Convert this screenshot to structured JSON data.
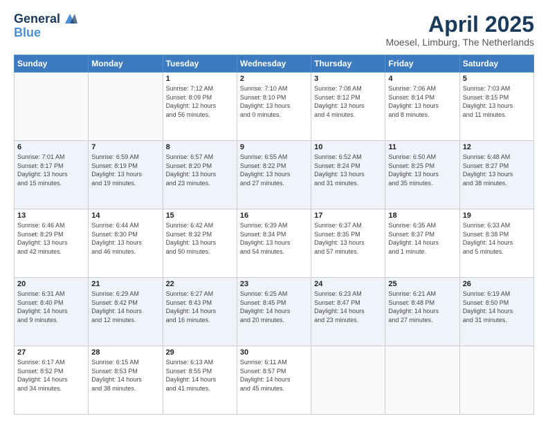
{
  "logo": {
    "line1": "General",
    "line2": "Blue"
  },
  "title": "April 2025",
  "subtitle": "Moesel, Limburg, The Netherlands",
  "weekdays": [
    "Sunday",
    "Monday",
    "Tuesday",
    "Wednesday",
    "Thursday",
    "Friday",
    "Saturday"
  ],
  "weeks": [
    [
      {
        "day": "",
        "info": ""
      },
      {
        "day": "",
        "info": ""
      },
      {
        "day": "1",
        "info": "Sunrise: 7:12 AM\nSunset: 8:09 PM\nDaylight: 12 hours\nand 56 minutes."
      },
      {
        "day": "2",
        "info": "Sunrise: 7:10 AM\nSunset: 8:10 PM\nDaylight: 13 hours\nand 0 minutes."
      },
      {
        "day": "3",
        "info": "Sunrise: 7:08 AM\nSunset: 8:12 PM\nDaylight: 13 hours\nand 4 minutes."
      },
      {
        "day": "4",
        "info": "Sunrise: 7:06 AM\nSunset: 8:14 PM\nDaylight: 13 hours\nand 8 minutes."
      },
      {
        "day": "5",
        "info": "Sunrise: 7:03 AM\nSunset: 8:15 PM\nDaylight: 13 hours\nand 11 minutes."
      }
    ],
    [
      {
        "day": "6",
        "info": "Sunrise: 7:01 AM\nSunset: 8:17 PM\nDaylight: 13 hours\nand 15 minutes."
      },
      {
        "day": "7",
        "info": "Sunrise: 6:59 AM\nSunset: 8:19 PM\nDaylight: 13 hours\nand 19 minutes."
      },
      {
        "day": "8",
        "info": "Sunrise: 6:57 AM\nSunset: 8:20 PM\nDaylight: 13 hours\nand 23 minutes."
      },
      {
        "day": "9",
        "info": "Sunrise: 6:55 AM\nSunset: 8:22 PM\nDaylight: 13 hours\nand 27 minutes."
      },
      {
        "day": "10",
        "info": "Sunrise: 6:52 AM\nSunset: 8:24 PM\nDaylight: 13 hours\nand 31 minutes."
      },
      {
        "day": "11",
        "info": "Sunrise: 6:50 AM\nSunset: 8:25 PM\nDaylight: 13 hours\nand 35 minutes."
      },
      {
        "day": "12",
        "info": "Sunrise: 6:48 AM\nSunset: 8:27 PM\nDaylight: 13 hours\nand 38 minutes."
      }
    ],
    [
      {
        "day": "13",
        "info": "Sunrise: 6:46 AM\nSunset: 8:29 PM\nDaylight: 13 hours\nand 42 minutes."
      },
      {
        "day": "14",
        "info": "Sunrise: 6:44 AM\nSunset: 8:30 PM\nDaylight: 13 hours\nand 46 minutes."
      },
      {
        "day": "15",
        "info": "Sunrise: 6:42 AM\nSunset: 8:32 PM\nDaylight: 13 hours\nand 50 minutes."
      },
      {
        "day": "16",
        "info": "Sunrise: 6:39 AM\nSunset: 8:34 PM\nDaylight: 13 hours\nand 54 minutes."
      },
      {
        "day": "17",
        "info": "Sunrise: 6:37 AM\nSunset: 8:35 PM\nDaylight: 13 hours\nand 57 minutes."
      },
      {
        "day": "18",
        "info": "Sunrise: 6:35 AM\nSunset: 8:37 PM\nDaylight: 14 hours\nand 1 minute."
      },
      {
        "day": "19",
        "info": "Sunrise: 6:33 AM\nSunset: 8:38 PM\nDaylight: 14 hours\nand 5 minutes."
      }
    ],
    [
      {
        "day": "20",
        "info": "Sunrise: 6:31 AM\nSunset: 8:40 PM\nDaylight: 14 hours\nand 9 minutes."
      },
      {
        "day": "21",
        "info": "Sunrise: 6:29 AM\nSunset: 8:42 PM\nDaylight: 14 hours\nand 12 minutes."
      },
      {
        "day": "22",
        "info": "Sunrise: 6:27 AM\nSunset: 8:43 PM\nDaylight: 14 hours\nand 16 minutes."
      },
      {
        "day": "23",
        "info": "Sunrise: 6:25 AM\nSunset: 8:45 PM\nDaylight: 14 hours\nand 20 minutes."
      },
      {
        "day": "24",
        "info": "Sunrise: 6:23 AM\nSunset: 8:47 PM\nDaylight: 14 hours\nand 23 minutes."
      },
      {
        "day": "25",
        "info": "Sunrise: 6:21 AM\nSunset: 8:48 PM\nDaylight: 14 hours\nand 27 minutes."
      },
      {
        "day": "26",
        "info": "Sunrise: 6:19 AM\nSunset: 8:50 PM\nDaylight: 14 hours\nand 31 minutes."
      }
    ],
    [
      {
        "day": "27",
        "info": "Sunrise: 6:17 AM\nSunset: 8:52 PM\nDaylight: 14 hours\nand 34 minutes."
      },
      {
        "day": "28",
        "info": "Sunrise: 6:15 AM\nSunset: 8:53 PM\nDaylight: 14 hours\nand 38 minutes."
      },
      {
        "day": "29",
        "info": "Sunrise: 6:13 AM\nSunset: 8:55 PM\nDaylight: 14 hours\nand 41 minutes."
      },
      {
        "day": "30",
        "info": "Sunrise: 6:11 AM\nSunset: 8:57 PM\nDaylight: 14 hours\nand 45 minutes."
      },
      {
        "day": "",
        "info": ""
      },
      {
        "day": "",
        "info": ""
      },
      {
        "day": "",
        "info": ""
      }
    ]
  ]
}
